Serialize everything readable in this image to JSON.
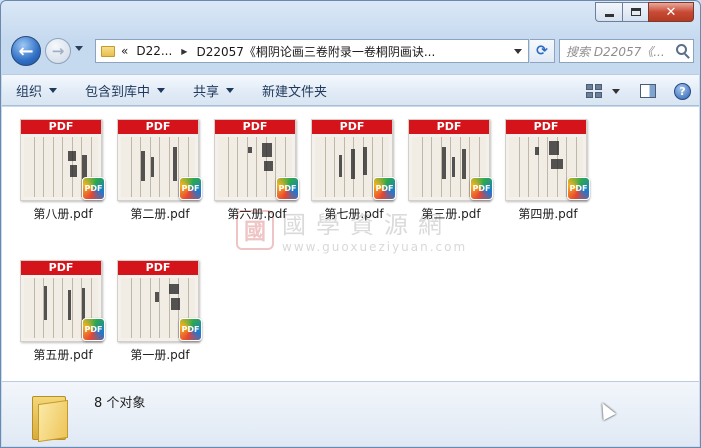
{
  "window": {
    "minimize_label": "",
    "maximize_label": "",
    "close_label": "✕"
  },
  "nav": {
    "back_glyph": "←",
    "forward_glyph": "→",
    "breadcrumb_overflow": "«",
    "breadcrumb": [
      "D22...",
      "D22057《桐阴论画三卷附录一卷桐阴画诀..."
    ],
    "refresh_glyph": "⟳",
    "search_placeholder": "搜索 D22057《..."
  },
  "toolbar": {
    "items": [
      {
        "label": "组织",
        "has_dropdown": true
      },
      {
        "label": "包含到库中",
        "has_dropdown": true
      },
      {
        "label": "共享",
        "has_dropdown": true
      },
      {
        "label": "新建文件夹",
        "has_dropdown": false
      }
    ],
    "help_glyph": "?"
  },
  "files": [
    {
      "name": "第八册.pdf",
      "banner": "PDF",
      "badge": "PDF"
    },
    {
      "name": "第二册.pdf",
      "banner": "PDF",
      "badge": "PDF"
    },
    {
      "name": "第六册.pdf",
      "banner": "PDF",
      "badge": "PDF"
    },
    {
      "name": "第七册.pdf",
      "banner": "PDF",
      "badge": "PDF"
    },
    {
      "name": "第三册.pdf",
      "banner": "PDF",
      "badge": "PDF"
    },
    {
      "name": "第四册.pdf",
      "banner": "PDF",
      "badge": "PDF"
    },
    {
      "name": "第五册.pdf",
      "banner": "PDF",
      "badge": "PDF"
    },
    {
      "name": "第一册.pdf",
      "banner": "PDF",
      "badge": "PDF"
    }
  ],
  "watermark": {
    "seal": "國",
    "chinese": "國學資源網",
    "url": "www.guoxueziyuan.com"
  },
  "status": {
    "item_count": "8 个对象"
  },
  "colors": {
    "pdf_red": "#d4141a",
    "accent_blue": "#1e395b"
  }
}
